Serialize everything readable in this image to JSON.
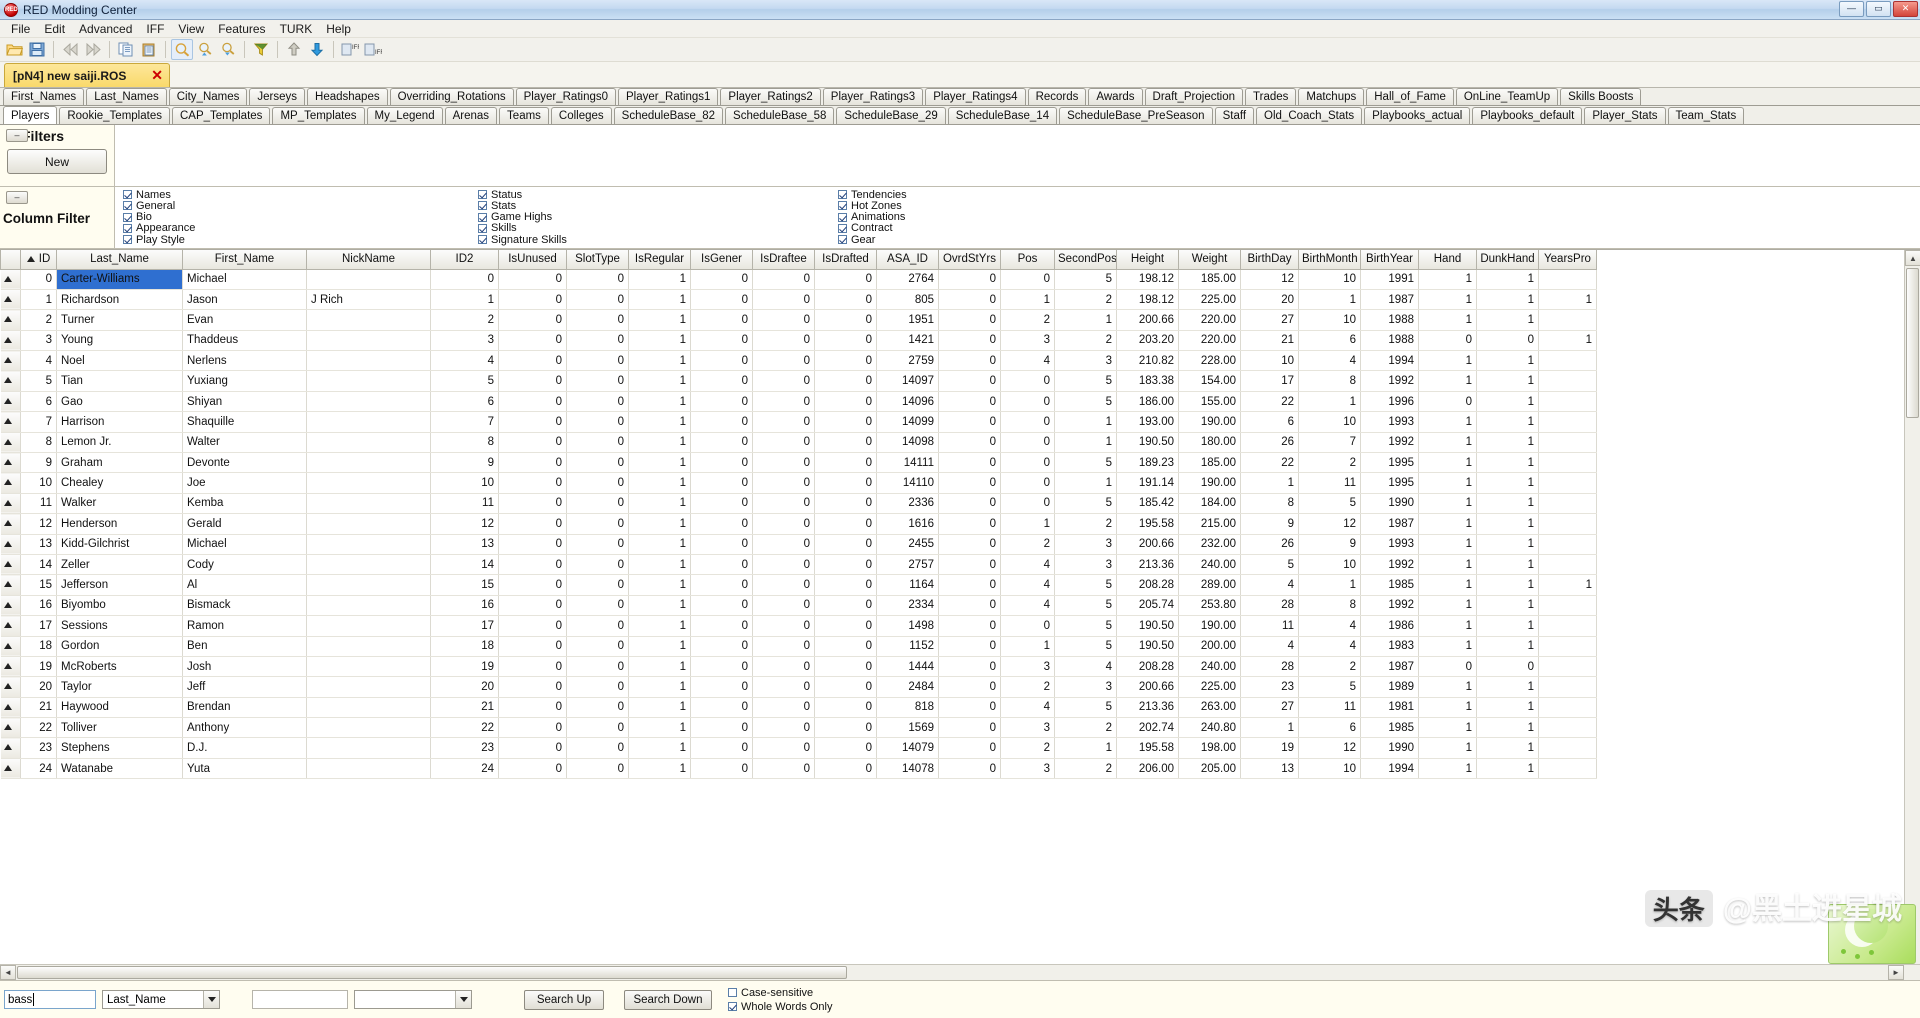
{
  "window": {
    "title": "RED Modding Center",
    "icon": "red-app-icon",
    "minimize": "—",
    "maximize": "▭",
    "close": "✕"
  },
  "menu": [
    "File",
    "Edit",
    "Advanced",
    "IFF",
    "View",
    "Features",
    "TURK",
    "Help"
  ],
  "toolbar": [
    {
      "name": "open-folder-icon",
      "kind": "icon"
    },
    {
      "name": "save-icon",
      "kind": "icon"
    },
    {
      "name": "separator",
      "kind": "sep"
    },
    {
      "name": "rewind-icon",
      "kind": "icon"
    },
    {
      "name": "fast-forward-icon",
      "kind": "icon"
    },
    {
      "name": "separator",
      "kind": "sep"
    },
    {
      "name": "copy-icon",
      "kind": "icon"
    },
    {
      "name": "paste-icon",
      "kind": "icon"
    },
    {
      "name": "separator",
      "kind": "sep"
    },
    {
      "name": "zoom-icon",
      "kind": "icon"
    },
    {
      "name": "zoom-in-icon",
      "kind": "icon"
    },
    {
      "name": "zoom-out-icon",
      "kind": "icon"
    },
    {
      "name": "separator",
      "kind": "sep"
    },
    {
      "name": "filter-icon",
      "kind": "icon"
    },
    {
      "name": "separator",
      "kind": "sep"
    },
    {
      "name": "move-up-icon",
      "kind": "icon"
    },
    {
      "name": "move-down-icon",
      "kind": "icon"
    },
    {
      "name": "separator",
      "kind": "sep"
    },
    {
      "name": "iff-import-icon",
      "kind": "icon",
      "label": "IFF"
    },
    {
      "name": "iff-export-icon",
      "kind": "icon",
      "label": "IFF"
    }
  ],
  "file_tab": {
    "label": "[pN4] new saiji.ROS",
    "close": "✕"
  },
  "top_tabs_row1": [
    "First_Names",
    "Last_Names",
    "City_Names",
    "Jerseys",
    "Headshapes",
    "Overriding_Rotations",
    "Player_Ratings0",
    "Player_Ratings1",
    "Player_Ratings2",
    "Player_Ratings3",
    "Player_Ratings4",
    "Records",
    "Awards",
    "Draft_Projection",
    "Trades",
    "Matchups",
    "Hall_of_Fame",
    "OnLine_TeamUp",
    "Skills Boosts"
  ],
  "top_tabs_row2": [
    "Players",
    "Rookie_Templates",
    "CAP_Templates",
    "MP_Templates",
    "My_Legend",
    "Arenas",
    "Teams",
    "Colleges",
    "ScheduleBase_82",
    "ScheduleBase_58",
    "ScheduleBase_29",
    "ScheduleBase_14",
    "ScheduleBase_PreSeason",
    "Staff",
    "Old_Coach_Stats",
    "Playbooks_actual",
    "Playbooks_default",
    "Player_Stats",
    "Team_Stats"
  ],
  "active_tab_row2": "Players",
  "filters": {
    "collapse": "–",
    "title": "Filters",
    "new_button": "New"
  },
  "column_filter": {
    "collapse": "–",
    "title": "Column Filter",
    "groups": [
      [
        {
          "label": "Names",
          "checked": true
        },
        {
          "label": "General",
          "checked": true
        },
        {
          "label": "Bio",
          "checked": true
        },
        {
          "label": "Appearance",
          "checked": true
        },
        {
          "label": "Play Style",
          "checked": true
        }
      ],
      [
        {
          "label": "Status",
          "checked": true
        },
        {
          "label": "Stats",
          "checked": true
        },
        {
          "label": "Game Highs",
          "checked": true
        },
        {
          "label": "Skills",
          "checked": true
        },
        {
          "label": "Signature Skills",
          "checked": true
        }
      ],
      [
        {
          "label": "Tendencies",
          "checked": true
        },
        {
          "label": "Hot Zones",
          "checked": true
        },
        {
          "label": "Animations",
          "checked": true
        },
        {
          "label": "Contract",
          "checked": true
        },
        {
          "label": "Gear",
          "checked": true
        }
      ]
    ]
  },
  "grid": {
    "sort_column": "ID",
    "columns": [
      "ID",
      "Last_Name",
      "First_Name",
      "NickName",
      "ID2",
      "IsUnused",
      "SlotType",
      "IsRegular",
      "IsGener",
      "IsDraftee",
      "IsDrafted",
      "ASA_ID",
      "OvrdStYrs",
      "Pos",
      "SecondPos",
      "Height",
      "Weight",
      "BirthDay",
      "BirthMonth",
      "BirthYear",
      "Hand",
      "DunkHand",
      "YearsPro"
    ],
    "selected_cell": {
      "row": 0,
      "column": "Last_Name",
      "value": "Carter-Williams"
    },
    "rows": [
      [
        "0",
        "Carter-Williams",
        "Michael",
        "",
        "0",
        "0",
        "0",
        "1",
        "0",
        "0",
        "0",
        "2764",
        "0",
        "0",
        "5",
        "198.12",
        "185.00",
        "12",
        "10",
        "1991",
        "1",
        "1",
        ""
      ],
      [
        "1",
        "Richardson",
        "Jason",
        "J Rich",
        "1",
        "0",
        "0",
        "1",
        "0",
        "0",
        "0",
        "805",
        "0",
        "1",
        "2",
        "198.12",
        "225.00",
        "20",
        "1",
        "1987",
        "1",
        "1",
        "1"
      ],
      [
        "2",
        "Turner",
        "Evan",
        "",
        "2",
        "0",
        "0",
        "1",
        "0",
        "0",
        "0",
        "1951",
        "0",
        "2",
        "1",
        "200.66",
        "220.00",
        "27",
        "10",
        "1988",
        "1",
        "1",
        ""
      ],
      [
        "3",
        "Young",
        "Thaddeus",
        "",
        "3",
        "0",
        "0",
        "1",
        "0",
        "0",
        "0",
        "1421",
        "0",
        "3",
        "2",
        "203.20",
        "220.00",
        "21",
        "6",
        "1988",
        "0",
        "0",
        "1"
      ],
      [
        "4",
        "Noel",
        "Nerlens",
        "",
        "4",
        "0",
        "0",
        "1",
        "0",
        "0",
        "0",
        "2759",
        "0",
        "4",
        "3",
        "210.82",
        "228.00",
        "10",
        "4",
        "1994",
        "1",
        "1",
        ""
      ],
      [
        "5",
        "Tian",
        "Yuxiang",
        "",
        "5",
        "0",
        "0",
        "1",
        "0",
        "0",
        "0",
        "14097",
        "0",
        "0",
        "5",
        "183.38",
        "154.00",
        "17",
        "8",
        "1992",
        "1",
        "1",
        ""
      ],
      [
        "6",
        "Gao",
        "Shiyan",
        "",
        "6",
        "0",
        "0",
        "1",
        "0",
        "0",
        "0",
        "14096",
        "0",
        "0",
        "5",
        "186.00",
        "155.00",
        "22",
        "1",
        "1996",
        "0",
        "1",
        ""
      ],
      [
        "7",
        "Harrison",
        "Shaquille",
        "",
        "7",
        "0",
        "0",
        "1",
        "0",
        "0",
        "0",
        "14099",
        "0",
        "0",
        "1",
        "193.00",
        "190.00",
        "6",
        "10",
        "1993",
        "1",
        "1",
        ""
      ],
      [
        "8",
        "Lemon Jr.",
        "Walter",
        "",
        "8",
        "0",
        "0",
        "1",
        "0",
        "0",
        "0",
        "14098",
        "0",
        "0",
        "1",
        "190.50",
        "180.00",
        "26",
        "7",
        "1992",
        "1",
        "1",
        ""
      ],
      [
        "9",
        "Graham",
        "Devonte",
        "",
        "9",
        "0",
        "0",
        "1",
        "0",
        "0",
        "0",
        "14111",
        "0",
        "0",
        "5",
        "189.23",
        "185.00",
        "22",
        "2",
        "1995",
        "1",
        "1",
        ""
      ],
      [
        "10",
        "Chealey",
        "Joe",
        "",
        "10",
        "0",
        "0",
        "1",
        "0",
        "0",
        "0",
        "14110",
        "0",
        "0",
        "1",
        "191.14",
        "190.00",
        "1",
        "11",
        "1995",
        "1",
        "1",
        ""
      ],
      [
        "11",
        "Walker",
        "Kemba",
        "",
        "11",
        "0",
        "0",
        "1",
        "0",
        "0",
        "0",
        "2336",
        "0",
        "0",
        "5",
        "185.42",
        "184.00",
        "8",
        "5",
        "1990",
        "1",
        "1",
        ""
      ],
      [
        "12",
        "Henderson",
        "Gerald",
        "",
        "12",
        "0",
        "0",
        "1",
        "0",
        "0",
        "0",
        "1616",
        "0",
        "1",
        "2",
        "195.58",
        "215.00",
        "9",
        "12",
        "1987",
        "1",
        "1",
        ""
      ],
      [
        "13",
        "Kidd-Gilchrist",
        "Michael",
        "",
        "13",
        "0",
        "0",
        "1",
        "0",
        "0",
        "0",
        "2455",
        "0",
        "2",
        "3",
        "200.66",
        "232.00",
        "26",
        "9",
        "1993",
        "1",
        "1",
        ""
      ],
      [
        "14",
        "Zeller",
        "Cody",
        "",
        "14",
        "0",
        "0",
        "1",
        "0",
        "0",
        "0",
        "2757",
        "0",
        "4",
        "3",
        "213.36",
        "240.00",
        "5",
        "10",
        "1992",
        "1",
        "1",
        ""
      ],
      [
        "15",
        "Jefferson",
        "Al",
        "",
        "15",
        "0",
        "0",
        "1",
        "0",
        "0",
        "0",
        "1164",
        "0",
        "4",
        "5",
        "208.28",
        "289.00",
        "4",
        "1",
        "1985",
        "1",
        "1",
        "1"
      ],
      [
        "16",
        "Biyombo",
        "Bismack",
        "",
        "16",
        "0",
        "0",
        "1",
        "0",
        "0",
        "0",
        "2334",
        "0",
        "4",
        "5",
        "205.74",
        "253.80",
        "28",
        "8",
        "1992",
        "1",
        "1",
        ""
      ],
      [
        "17",
        "Sessions",
        "Ramon",
        "",
        "17",
        "0",
        "0",
        "1",
        "0",
        "0",
        "0",
        "1498",
        "0",
        "0",
        "5",
        "190.50",
        "190.00",
        "11",
        "4",
        "1986",
        "1",
        "1",
        ""
      ],
      [
        "18",
        "Gordon",
        "Ben",
        "",
        "18",
        "0",
        "0",
        "1",
        "0",
        "0",
        "0",
        "1152",
        "0",
        "1",
        "5",
        "190.50",
        "200.00",
        "4",
        "4",
        "1983",
        "1",
        "1",
        ""
      ],
      [
        "19",
        "McRoberts",
        "Josh",
        "",
        "19",
        "0",
        "0",
        "1",
        "0",
        "0",
        "0",
        "1444",
        "0",
        "3",
        "4",
        "208.28",
        "240.00",
        "28",
        "2",
        "1987",
        "0",
        "0",
        ""
      ],
      [
        "20",
        "Taylor",
        "Jeff",
        "",
        "20",
        "0",
        "0",
        "1",
        "0",
        "0",
        "0",
        "2484",
        "0",
        "2",
        "3",
        "200.66",
        "225.00",
        "23",
        "5",
        "1989",
        "1",
        "1",
        ""
      ],
      [
        "21",
        "Haywood",
        "Brendan",
        "",
        "21",
        "0",
        "0",
        "1",
        "0",
        "0",
        "0",
        "818",
        "0",
        "4",
        "5",
        "213.36",
        "263.00",
        "27",
        "11",
        "1981",
        "1",
        "1",
        ""
      ],
      [
        "22",
        "Tolliver",
        "Anthony",
        "",
        "22",
        "0",
        "0",
        "1",
        "0",
        "0",
        "0",
        "1569",
        "0",
        "3",
        "2",
        "202.74",
        "240.80",
        "1",
        "6",
        "1985",
        "1",
        "1",
        ""
      ],
      [
        "23",
        "Stephens",
        "D.J.",
        "",
        "23",
        "0",
        "0",
        "1",
        "0",
        "0",
        "0",
        "14079",
        "0",
        "2",
        "1",
        "195.58",
        "198.00",
        "19",
        "12",
        "1990",
        "1",
        "1",
        ""
      ],
      [
        "24",
        "Watanabe",
        "Yuta",
        "",
        "24",
        "0",
        "0",
        "1",
        "0",
        "0",
        "0",
        "14078",
        "0",
        "3",
        "2",
        "206.00",
        "205.00",
        "13",
        "10",
        "1994",
        "1",
        "1",
        ""
      ]
    ]
  },
  "search": {
    "query_value": "bass",
    "query_placeholder": "",
    "field_select": "Last_Name",
    "second_value": "",
    "second_select": "",
    "search_up": "Search Up",
    "search_down": "Search Down",
    "case_sensitive": {
      "label": "Case-sensitive",
      "checked": false
    },
    "whole_words": {
      "label": "Whole Words Only",
      "checked": true
    }
  },
  "watermark": {
    "badge": "头条",
    "text": "@黑土进星城"
  },
  "scrollbars": {
    "up": "▲",
    "down": "▼",
    "left": "◄",
    "right": "►"
  }
}
